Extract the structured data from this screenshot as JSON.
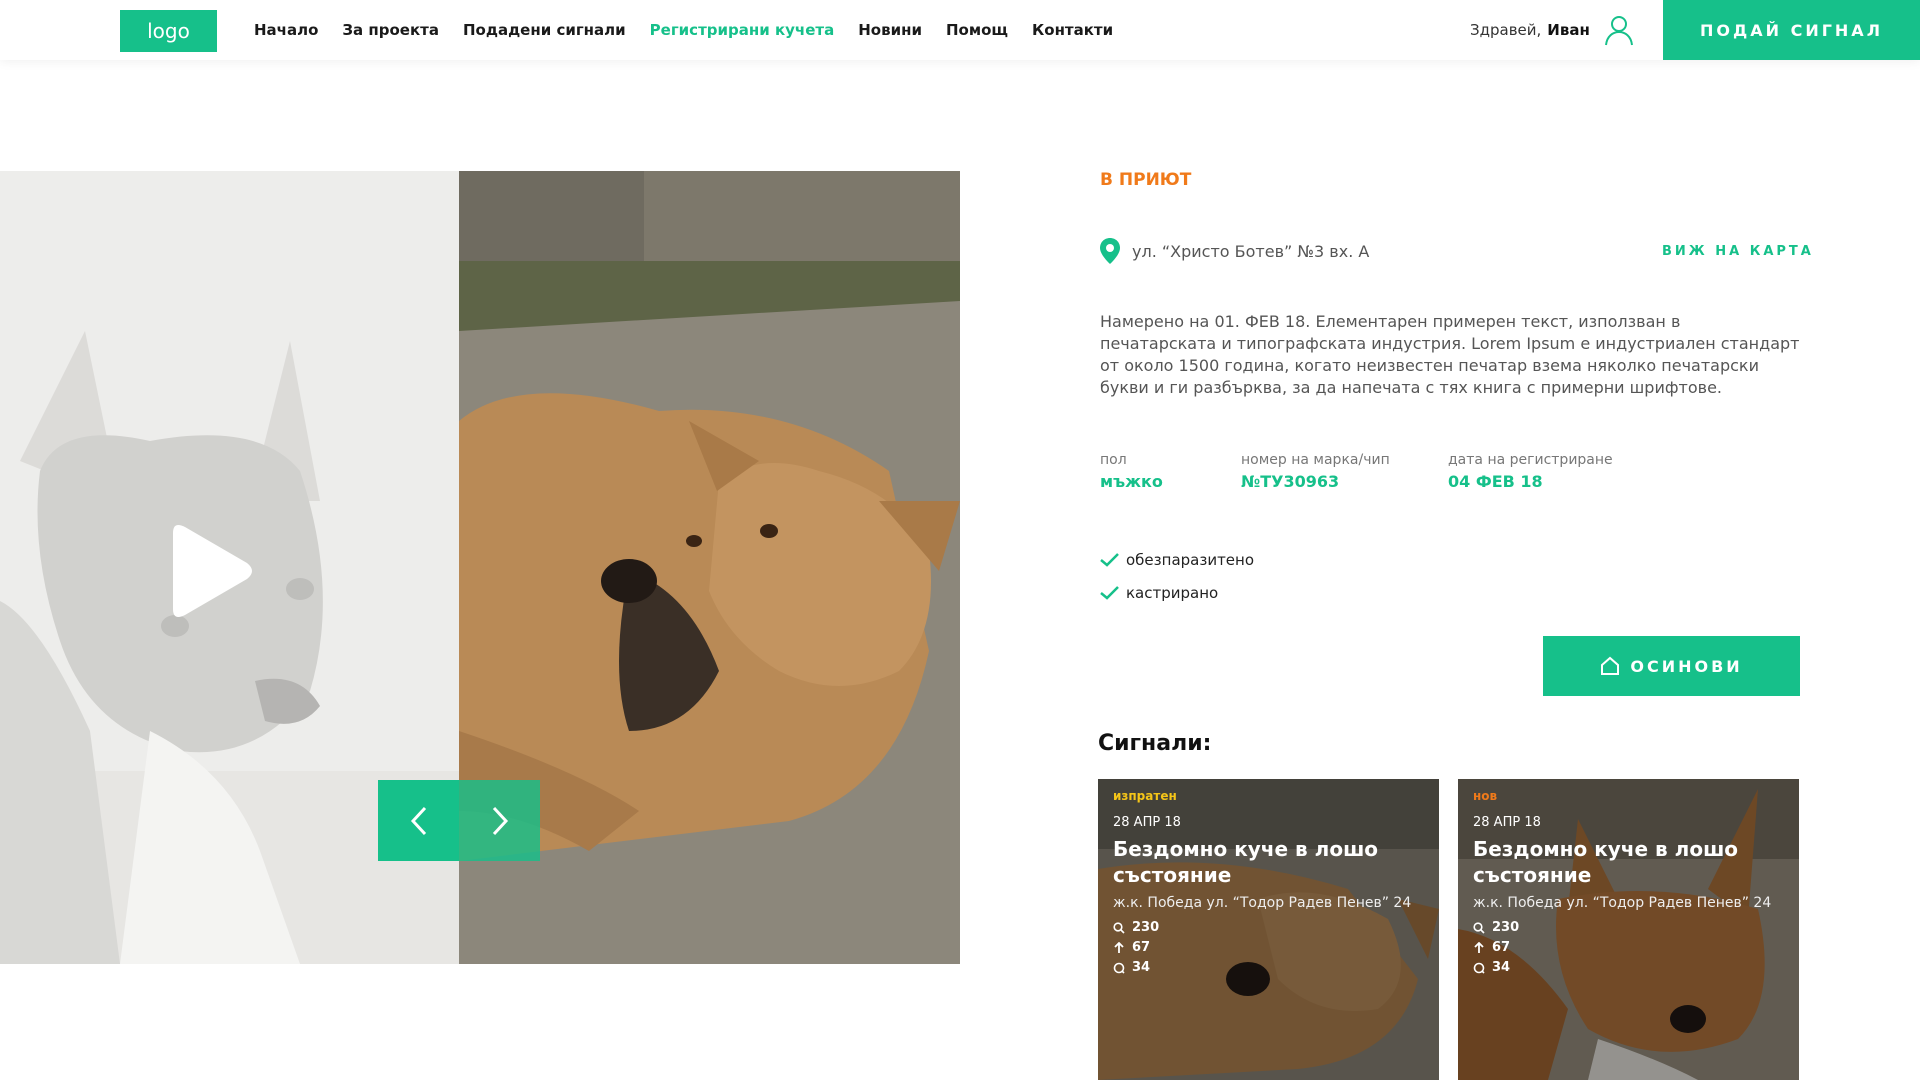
{
  "header": {
    "logo": "logo",
    "nav": [
      "Начало",
      "За проекта",
      "Подадени сигнали",
      "Регистрирани кучета",
      "Новини",
      "Помощ",
      "Контакти"
    ],
    "active_nav": "Регистрирани кучета",
    "greeting": "Здравей,",
    "user_name": "Иван",
    "signal_button": "ПОДАЙ СИГНАЛ"
  },
  "dog": {
    "status": "В ПРИЮТ",
    "address": "ул. “Христо Ботев” №3 вх. А",
    "map_link": "ВИЖ НА КАРТА",
    "description": "Намерено на 01. ФЕВ 18. Елементарен примерен текст, използван в печатарската и типографската индустрия. Lorem Ipsum е индустриален стандарт от около 1500 година, когато неизвестен печатар взема няколко печатарски букви и ги разбърква, за да напечата с тях книга с примерни шрифтове.",
    "gender_label": "пол",
    "gender_value": "мъжко",
    "chip_label": "номер на марка/чип",
    "chip_value": "№ТУ30963",
    "reg_label": "дата на регистриране",
    "reg_value": "04 ФЕВ 18",
    "checks": [
      "обезпаразитено",
      "кастрирано"
    ],
    "adopt_button": "ОСИНОВИ"
  },
  "signals": {
    "title": "Сигнали:",
    "cards": [
      {
        "status": "изпратен",
        "date": "28 АПР 18",
        "title": "Бездомно куче в лошо състояние",
        "address": "ж.к. Победа ул. “Тодор Радев Пенев” 24",
        "views": "230",
        "upvotes": "67",
        "comments": "34"
      },
      {
        "status": "нов",
        "date": "28 АПР 18",
        "title": "Бездомно куче в лошо състояние",
        "address": "ж.к. Победа ул. “Тодор Радев Пенев” 24",
        "views": "230",
        "upvotes": "67",
        "comments": "34"
      }
    ]
  },
  "colors": {
    "accent": "#16c08a",
    "status_orange": "#f07a1a",
    "status_yellow": "#f5c518"
  }
}
